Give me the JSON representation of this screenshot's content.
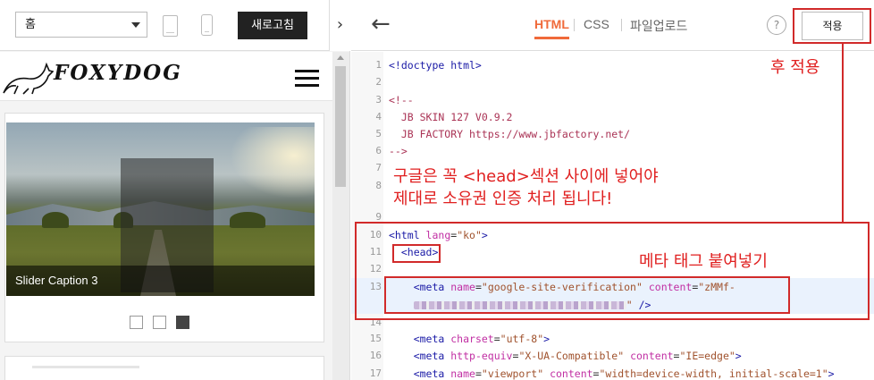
{
  "left_panel": {
    "view_select": "홈",
    "refresh_label": "새로고침",
    "collapse_glyph": "›",
    "blog": {
      "logo_text": "FOXYDOG",
      "slider_caption": "Slider Caption 3",
      "slide_count": 3,
      "active_slide_index": 2
    }
  },
  "editor": {
    "back_glyph": "←",
    "tabs": [
      "HTML",
      "CSS",
      "파일업로드"
    ],
    "active_tab": "HTML",
    "help_label": "?",
    "apply_label": "적용",
    "lines": [
      {
        "n": "1",
        "text": "<!doctype html>"
      },
      {
        "n": "2",
        "text": ""
      },
      {
        "n": "3",
        "text": "<!--"
      },
      {
        "n": "4",
        "text": "  JB SKIN 127 V0.9.2"
      },
      {
        "n": "5",
        "text": "  JB FACTORY https://www.jbfactory.net/"
      },
      {
        "n": "6",
        "text": "-->"
      },
      {
        "n": "7",
        "text": ""
      },
      {
        "n": "8",
        "text": ""
      },
      {
        "n": "9",
        "text": ""
      },
      {
        "n": "10",
        "tag_open": "<html ",
        "attr": "lang",
        "eq": "=",
        "val": "\"ko\"",
        "tag_close": ">"
      },
      {
        "n": "11",
        "text": "<head>"
      },
      {
        "n": "12",
        "text": ""
      },
      {
        "n": "13",
        "tag_open": "<meta ",
        "attr1": "name",
        "val1": "\"google-site-verification\"",
        "attr2": "content",
        "val2": "\"zMMf-"
      },
      {
        "n": "",
        "tail": "\" />"
      },
      {
        "n": "14",
        "text": ""
      },
      {
        "n": "15",
        "tag_open": "<meta ",
        "attr": "charset",
        "eq": "=",
        "val": "\"utf-8\"",
        "tag_close": ">"
      },
      {
        "n": "16",
        "tag_open": "<meta ",
        "attr1": "http-equiv",
        "val1": "\"X-UA-Compatible\"",
        "attr2": "content",
        "val2": "\"IE=edge\"",
        "tag_close": ">"
      },
      {
        "n": "17",
        "tag_open": "<meta ",
        "attr1": "name",
        "val1": "\"viewport\"",
        "attr2": "content",
        "val2": "\"width=device-width, initial-scale=1\"",
        "tag_close": ">"
      }
    ]
  },
  "annotations": {
    "apply_note": "후 적용",
    "head_note_line1": "구글은 꼭 <head>섹션 사이에 넣어야",
    "head_note_line2": "제대로 소유권 인증 처리 됩니다!",
    "meta_note": "메타 태그 붙여넣기",
    "color": "#d12a2a"
  },
  "colors": {
    "accent": "#f06a3a",
    "dark_button": "#222222",
    "code_tag": "#1a1aa6",
    "code_attr": "#c12fa3",
    "code_value": "#a0522d"
  }
}
